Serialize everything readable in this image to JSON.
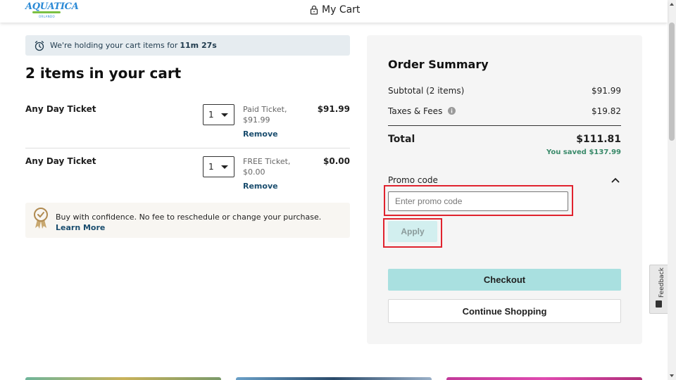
{
  "header": {
    "logo_text": "AQUATICA",
    "logo_subtext": "ORLANDO",
    "title": "My Cart"
  },
  "timer": {
    "text": "We're holding your cart items for",
    "remaining": "11m 27s"
  },
  "cart": {
    "heading": "2 items in your cart",
    "items": [
      {
        "name": "Any Day Ticket",
        "quantity": "1",
        "description": "Paid Ticket, $91.99",
        "remove_label": "Remove",
        "price": "$91.99"
      },
      {
        "name": "Any Day Ticket",
        "quantity": "1",
        "description": "FREE Ticket, $0.00",
        "remove_label": "Remove",
        "price": "$0.00"
      }
    ]
  },
  "confidence": {
    "text": "Buy with confidence. No fee to reschedule or change your purchase.",
    "link_label": "Learn More"
  },
  "summary": {
    "title": "Order Summary",
    "subtotal_label": "Subtotal (2 items)",
    "subtotal_value": "$91.99",
    "taxes_label": "Taxes & Fees",
    "taxes_value": "$19.82",
    "total_label": "Total",
    "total_value": "$111.81",
    "saved_text": "You saved $137.99",
    "promo_label": "Promo code",
    "promo_placeholder": "Enter promo code",
    "apply_label": "Apply",
    "checkout_label": "Checkout",
    "continue_label": "Continue Shopping"
  },
  "feedback": {
    "label": "Feedback"
  },
  "colors": {
    "checkout_bg": "#a9e0e0",
    "apply_bg": "#d2efef",
    "saved_text": "#3a8a6a",
    "link": "#1a4d6e",
    "highlight": "#e0232e"
  }
}
